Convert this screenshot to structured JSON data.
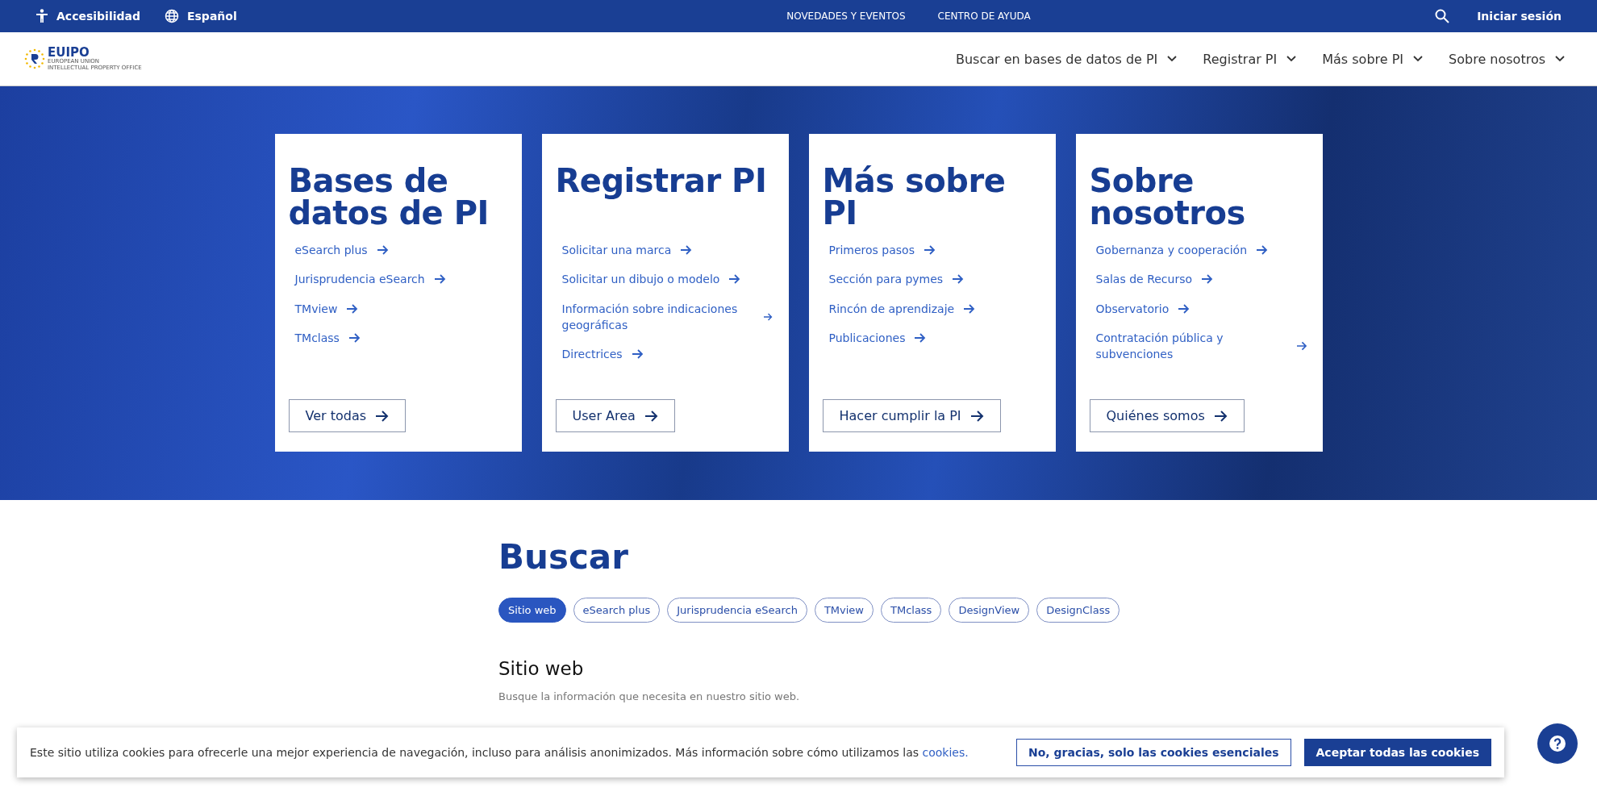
{
  "top_bar": {
    "left": [
      {
        "kind": "accessibility",
        "label": "Accesibilidad"
      },
      {
        "kind": "language",
        "label": "Español"
      }
    ],
    "center": [
      "NOVEDADES Y EVENTOS",
      "CENTRO DE AYUDA"
    ],
    "login": "Iniciar sesión"
  },
  "header": {
    "logo": {
      "name": "EUIPO",
      "subtitle": [
        "EUROPEAN UNION",
        "INTELLECTUAL PROPERTY OFFICE"
      ]
    },
    "nav": [
      "Buscar en bases de datos de PI",
      "Registrar PI",
      "Más sobre PI",
      "Sobre nosotros"
    ]
  },
  "cards": [
    {
      "title": "Bases de datos de PI",
      "links": [
        "eSearch plus",
        "Jurisprudencia eSearch",
        "TMview",
        "TMclass"
      ],
      "button": "Ver todas"
    },
    {
      "title": "Registrar PI",
      "links": [
        "Solicitar una marca",
        "Solicitar un dibujo o modelo",
        "Información sobre indicaciones geográficas",
        "Directrices"
      ],
      "button": "User Area"
    },
    {
      "title": "Más sobre PI",
      "links": [
        "Primeros pasos",
        "Sección para pymes",
        "Rincón de aprendizaje",
        "Publicaciones"
      ],
      "button": "Hacer cumplir la PI"
    },
    {
      "title": "Sobre nosotros",
      "links": [
        "Gobernanza y cooperación",
        "Salas de Recurso",
        "Observatorio",
        "Contratación pública y subvenciones"
      ],
      "button": "Quiénes somos"
    }
  ],
  "search": {
    "title": "Buscar",
    "tabs": [
      {
        "label": "Sitio web",
        "selected": true
      },
      {
        "label": "eSearch plus",
        "selected": false
      },
      {
        "label": "Jurisprudencia eSearch",
        "selected": false
      },
      {
        "label": "TMview",
        "selected": false
      },
      {
        "label": "TMclass",
        "selected": false
      },
      {
        "label": "DesignView",
        "selected": false
      },
      {
        "label": "DesignClass",
        "selected": false
      }
    ],
    "heading": "Sitio web",
    "description": "Busque la información que necesita en nuestro sitio web."
  },
  "cookie_banner": {
    "text": "Este sitio utiliza cookies para ofrecerle una mejor experiencia de navegación, incluso para análisis anonimizados. Más información sobre cómo utilizamos las",
    "link": "cookies.",
    "decline": "No, gracias, solo las cookies esenciales",
    "accept": "Aceptar todas las cookies"
  }
}
